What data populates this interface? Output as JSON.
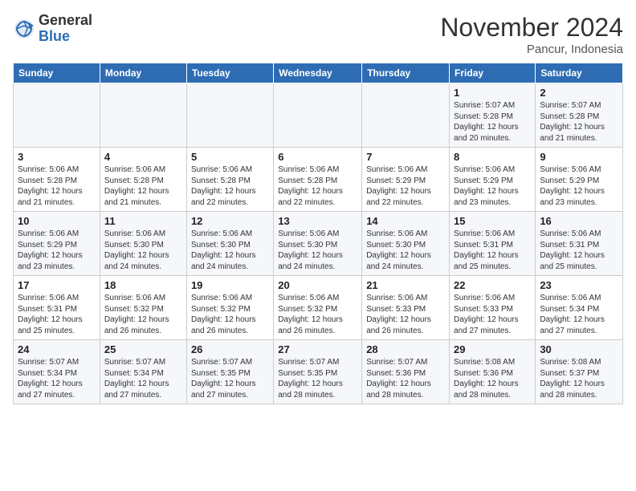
{
  "logo": {
    "general": "General",
    "blue": "Blue"
  },
  "title": "November 2024",
  "location": "Pancur, Indonesia",
  "days_of_week": [
    "Sunday",
    "Monday",
    "Tuesday",
    "Wednesday",
    "Thursday",
    "Friday",
    "Saturday"
  ],
  "weeks": [
    [
      {
        "day": "",
        "info": ""
      },
      {
        "day": "",
        "info": ""
      },
      {
        "day": "",
        "info": ""
      },
      {
        "day": "",
        "info": ""
      },
      {
        "day": "",
        "info": ""
      },
      {
        "day": "1",
        "info": "Sunrise: 5:07 AM\nSunset: 5:28 PM\nDaylight: 12 hours\nand 20 minutes."
      },
      {
        "day": "2",
        "info": "Sunrise: 5:07 AM\nSunset: 5:28 PM\nDaylight: 12 hours\nand 21 minutes."
      }
    ],
    [
      {
        "day": "3",
        "info": "Sunrise: 5:06 AM\nSunset: 5:28 PM\nDaylight: 12 hours\nand 21 minutes."
      },
      {
        "day": "4",
        "info": "Sunrise: 5:06 AM\nSunset: 5:28 PM\nDaylight: 12 hours\nand 21 minutes."
      },
      {
        "day": "5",
        "info": "Sunrise: 5:06 AM\nSunset: 5:28 PM\nDaylight: 12 hours\nand 22 minutes."
      },
      {
        "day": "6",
        "info": "Sunrise: 5:06 AM\nSunset: 5:28 PM\nDaylight: 12 hours\nand 22 minutes."
      },
      {
        "day": "7",
        "info": "Sunrise: 5:06 AM\nSunset: 5:29 PM\nDaylight: 12 hours\nand 22 minutes."
      },
      {
        "day": "8",
        "info": "Sunrise: 5:06 AM\nSunset: 5:29 PM\nDaylight: 12 hours\nand 23 minutes."
      },
      {
        "day": "9",
        "info": "Sunrise: 5:06 AM\nSunset: 5:29 PM\nDaylight: 12 hours\nand 23 minutes."
      }
    ],
    [
      {
        "day": "10",
        "info": "Sunrise: 5:06 AM\nSunset: 5:29 PM\nDaylight: 12 hours\nand 23 minutes."
      },
      {
        "day": "11",
        "info": "Sunrise: 5:06 AM\nSunset: 5:30 PM\nDaylight: 12 hours\nand 24 minutes."
      },
      {
        "day": "12",
        "info": "Sunrise: 5:06 AM\nSunset: 5:30 PM\nDaylight: 12 hours\nand 24 minutes."
      },
      {
        "day": "13",
        "info": "Sunrise: 5:06 AM\nSunset: 5:30 PM\nDaylight: 12 hours\nand 24 minutes."
      },
      {
        "day": "14",
        "info": "Sunrise: 5:06 AM\nSunset: 5:30 PM\nDaylight: 12 hours\nand 24 minutes."
      },
      {
        "day": "15",
        "info": "Sunrise: 5:06 AM\nSunset: 5:31 PM\nDaylight: 12 hours\nand 25 minutes."
      },
      {
        "day": "16",
        "info": "Sunrise: 5:06 AM\nSunset: 5:31 PM\nDaylight: 12 hours\nand 25 minutes."
      }
    ],
    [
      {
        "day": "17",
        "info": "Sunrise: 5:06 AM\nSunset: 5:31 PM\nDaylight: 12 hours\nand 25 minutes."
      },
      {
        "day": "18",
        "info": "Sunrise: 5:06 AM\nSunset: 5:32 PM\nDaylight: 12 hours\nand 26 minutes."
      },
      {
        "day": "19",
        "info": "Sunrise: 5:06 AM\nSunset: 5:32 PM\nDaylight: 12 hours\nand 26 minutes."
      },
      {
        "day": "20",
        "info": "Sunrise: 5:06 AM\nSunset: 5:32 PM\nDaylight: 12 hours\nand 26 minutes."
      },
      {
        "day": "21",
        "info": "Sunrise: 5:06 AM\nSunset: 5:33 PM\nDaylight: 12 hours\nand 26 minutes."
      },
      {
        "day": "22",
        "info": "Sunrise: 5:06 AM\nSunset: 5:33 PM\nDaylight: 12 hours\nand 27 minutes."
      },
      {
        "day": "23",
        "info": "Sunrise: 5:06 AM\nSunset: 5:34 PM\nDaylight: 12 hours\nand 27 minutes."
      }
    ],
    [
      {
        "day": "24",
        "info": "Sunrise: 5:07 AM\nSunset: 5:34 PM\nDaylight: 12 hours\nand 27 minutes."
      },
      {
        "day": "25",
        "info": "Sunrise: 5:07 AM\nSunset: 5:34 PM\nDaylight: 12 hours\nand 27 minutes."
      },
      {
        "day": "26",
        "info": "Sunrise: 5:07 AM\nSunset: 5:35 PM\nDaylight: 12 hours\nand 27 minutes."
      },
      {
        "day": "27",
        "info": "Sunrise: 5:07 AM\nSunset: 5:35 PM\nDaylight: 12 hours\nand 28 minutes."
      },
      {
        "day": "28",
        "info": "Sunrise: 5:07 AM\nSunset: 5:36 PM\nDaylight: 12 hours\nand 28 minutes."
      },
      {
        "day": "29",
        "info": "Sunrise: 5:08 AM\nSunset: 5:36 PM\nDaylight: 12 hours\nand 28 minutes."
      },
      {
        "day": "30",
        "info": "Sunrise: 5:08 AM\nSunset: 5:37 PM\nDaylight: 12 hours\nand 28 minutes."
      }
    ]
  ]
}
